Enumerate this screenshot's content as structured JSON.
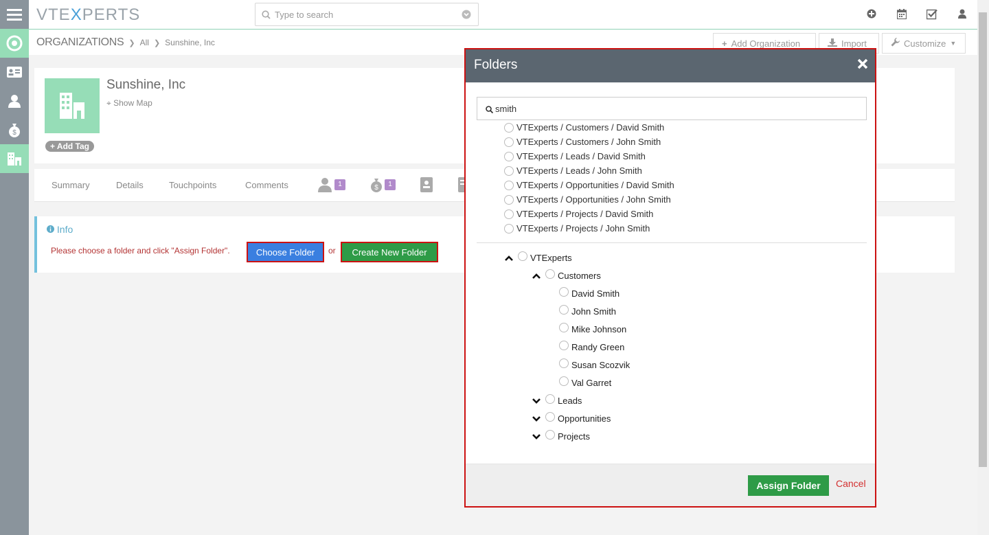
{
  "app": {
    "logo_pre": "VTE",
    "logo_x": "X",
    "logo_post": "PERTS",
    "search_placeholder": "Type to search"
  },
  "breadcrumb": {
    "module": "ORGANIZATIONS",
    "filter": "All",
    "record": "Sunshine, Inc"
  },
  "header_actions": {
    "add_org": "Add Organization",
    "import": "Import",
    "customize": "Customize"
  },
  "record": {
    "name": "Sunshine, Inc",
    "show_map": "Show Map",
    "add_tag": "Add Tag"
  },
  "tabs": {
    "summary": "Summary",
    "details": "Details",
    "touchpoints": "Touchpoints",
    "comments": "Comments",
    "contacts_count": "1",
    "deals_count": "1"
  },
  "info": {
    "title": "Info",
    "message": "Please choose a folder and click \"Assign Folder\".",
    "choose_folder": "Choose Folder",
    "or": "or",
    "create_folder": "Create New Folder"
  },
  "modal": {
    "title": "Folders",
    "search_value": "smith",
    "results": [
      "VTExperts / Customers / David Smith",
      "VTExperts / Customers / John Smith",
      "VTExperts / Leads / David Smith",
      "VTExperts / Leads / John Smith",
      "VTExperts / Opportunities / David Smith",
      "VTExperts / Opportunities / John Smith",
      "VTExperts / Projects / David Smith",
      "VTExperts / Projects / John Smith"
    ],
    "tree": {
      "root": "VTExperts",
      "customers": "Customers",
      "customer_children": [
        "David Smith",
        "John Smith",
        "Mike Johnson",
        "Randy Green",
        "Susan Scozvik",
        "Val Garret"
      ],
      "leads": "Leads",
      "opportunities": "Opportunities",
      "projects": "Projects"
    },
    "assign": "Assign Folder",
    "cancel": "Cancel"
  },
  "colors": {
    "rail": "#8a949c",
    "modal_header": "#5b6670",
    "green": "#2e9b47",
    "blue": "#3a7fe0",
    "highlight_border": "#cc1111"
  }
}
